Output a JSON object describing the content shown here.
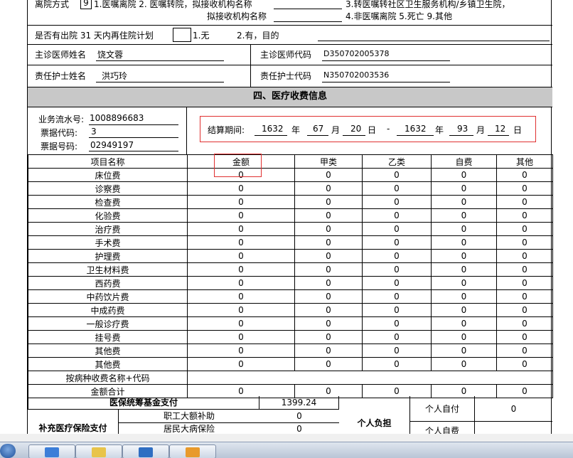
{
  "discharge": {
    "line1": "离院方式",
    "code": "9",
    "opt1": "1.医嘱离院 2. 医嘱转院，拟接收机构名称",
    "opt3": "3.转医嘱转社区卫生服务机构/乡镇卫生院，",
    "line2_label": "拟接收机构名称",
    "opt4": "4.非医嘱离院 5.死亡 9.其他"
  },
  "readmit": {
    "label": "是否有出院 31 天内再住院计划",
    "opt1": "1.无",
    "opt2": "2.有，目的"
  },
  "doctor": {
    "name_label": "主诊医师姓名",
    "name": "饶文蓉",
    "code_label": "主诊医师代码",
    "code": "D350702005378"
  },
  "nurse": {
    "name_label": "责任护士姓名",
    "name": "洪巧玲",
    "code_label": "责任护士代码",
    "code": "N350702003536"
  },
  "section_title": "四、医疗收费信息",
  "billing": {
    "serial_label": "业务流水号:",
    "serial": "1008896683",
    "ticket_code_label": "票据代码:",
    "ticket_code": "3",
    "ticket_no_label": "票据号码:",
    "ticket_no": "02949197",
    "period_label": "结算期间:",
    "y1": "1632",
    "m1": "67",
    "d1": "20",
    "y2": "1632",
    "m2": "93",
    "d2": "12",
    "year_char": "年",
    "month_char": "月",
    "day_char": "日",
    "dash": "-"
  },
  "fee_table": {
    "headers": [
      "项目名称",
      "金额",
      "甲类",
      "乙类",
      "自费",
      "其他"
    ],
    "rows": [
      [
        "床位费",
        "0",
        "0",
        "0",
        "0",
        "0"
      ],
      [
        "诊察费",
        "0",
        "0",
        "0",
        "0",
        "0"
      ],
      [
        "检查费",
        "0",
        "0",
        "0",
        "0",
        "0"
      ],
      [
        "化验费",
        "0",
        "0",
        "0",
        "0",
        "0"
      ],
      [
        "治疗费",
        "0",
        "0",
        "0",
        "0",
        "0"
      ],
      [
        "手术费",
        "0",
        "0",
        "0",
        "0",
        "0"
      ],
      [
        "护理费",
        "0",
        "0",
        "0",
        "0",
        "0"
      ],
      [
        "卫生材料费",
        "0",
        "0",
        "0",
        "0",
        "0"
      ],
      [
        "西药费",
        "0",
        "0",
        "0",
        "0",
        "0"
      ],
      [
        "中药饮片费",
        "0",
        "0",
        "0",
        "0",
        "0"
      ],
      [
        "中成药费",
        "0",
        "0",
        "0",
        "0",
        "0"
      ],
      [
        "一般诊疗费",
        "0",
        "0",
        "0",
        "0",
        "0"
      ],
      [
        "挂号费",
        "0",
        "0",
        "0",
        "0",
        "0"
      ],
      [
        "其他费",
        "0",
        "0",
        "0",
        "0",
        "0"
      ],
      [
        "其他费",
        "0",
        "0",
        "0",
        "0",
        "0"
      ]
    ],
    "disease_label": "按病种收费名称+代码",
    "total_label": "金额合计",
    "total_values": [
      "0",
      "0",
      "0",
      "0",
      "0"
    ]
  },
  "insurance": {
    "fund_label": "医保统筹基金支付",
    "fund_value": "1399.24",
    "personal_label": "个人负担",
    "self_pay_label": "个人自付",
    "self_pay_value": "0",
    "self_fee_label": "个人自费",
    "supp_label": "补充医疗保险支付",
    "worker_label": "职工大额补助",
    "worker_value": "0",
    "resident_label": "居民大病保险",
    "resident_value": "0"
  }
}
